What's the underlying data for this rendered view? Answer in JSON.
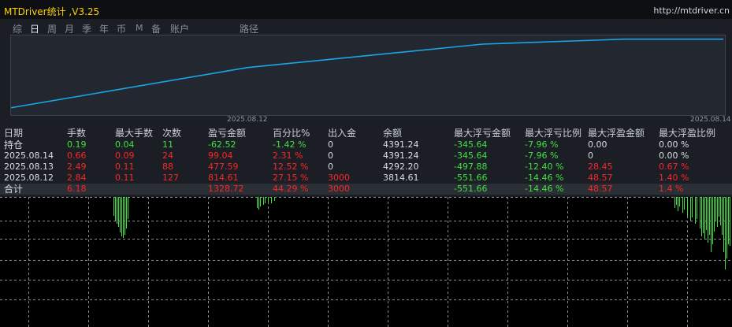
{
  "app": {
    "title": "MTDriver统计 ,V3.25",
    "url": "http://mtdriver.cn"
  },
  "period_tabs": [
    {
      "label": "综",
      "active": false
    },
    {
      "label": "日",
      "active": true
    },
    {
      "label": "周",
      "active": false
    },
    {
      "label": "月",
      "active": false
    },
    {
      "label": "季",
      "active": false
    },
    {
      "label": "年",
      "active": false
    },
    {
      "label": "币",
      "active": false
    },
    {
      "label": "M",
      "active": false
    },
    {
      "label": "备",
      "active": false
    },
    {
      "label": "账户",
      "active": false
    },
    {
      "label": "路径",
      "active": false
    }
  ],
  "equity_chart": {
    "start_date": "2025.08.12",
    "end_date": "2025.08.14",
    "line_color": "#1aa6e6",
    "values": [
      3000,
      3814.61,
      4292.2,
      4391.24,
      4391.24
    ]
  },
  "table": {
    "headers": [
      "日期",
      "手数",
      "最大手数",
      "次数",
      "盈亏金额",
      "百分比%",
      "出入金",
      "余额",
      "最大浮亏金额",
      "最大浮亏比例",
      "最大浮盈金额",
      "最大浮盈比例"
    ],
    "rows": [
      {
        "name": "positions",
        "cells": [
          "持仓",
          "0.19",
          "0.04",
          "11",
          "-62.52",
          "-1.42 %",
          "0",
          "4391.24",
          "-345.64",
          "-7.96 %",
          "0.00",
          "0.00 %"
        ],
        "colors": [
          "white",
          "green",
          "green",
          "green",
          "green",
          "green",
          "white",
          "white",
          "green",
          "green",
          "white",
          "white"
        ]
      },
      {
        "name": "day-2025-08-14",
        "cells": [
          "2025.08.14",
          "0.66",
          "0.09",
          "24",
          "99.04",
          "2.31 %",
          "0",
          "4391.24",
          "-345.64",
          "-7.96 %",
          "0",
          "0.00 %"
        ],
        "colors": [
          "white",
          "red",
          "red",
          "red",
          "red",
          "red",
          "white",
          "white",
          "green",
          "green",
          "white",
          "white"
        ]
      },
      {
        "name": "day-2025-08-13",
        "cells": [
          "2025.08.13",
          "2.49",
          "0.11",
          "88",
          "477.59",
          "12.52 %",
          "0",
          "4292.20",
          "-497.88",
          "-12.40 %",
          "28.45",
          "0.67 %"
        ],
        "colors": [
          "white",
          "red",
          "red",
          "red",
          "red",
          "red",
          "white",
          "white",
          "green",
          "green",
          "red",
          "red"
        ]
      },
      {
        "name": "day-2025-08-12",
        "cells": [
          "2025.08.12",
          "2.84",
          "0.11",
          "127",
          "814.61",
          "27.15 %",
          "3000",
          "3814.61",
          "-551.66",
          "-14.46 %",
          "48.57",
          "1.40 %"
        ],
        "colors": [
          "white",
          "red",
          "red",
          "red",
          "red",
          "red",
          "red",
          "white",
          "green",
          "green",
          "red",
          "red"
        ]
      },
      {
        "name": "total",
        "cells": [
          "合计",
          "6.18",
          "",
          "",
          "1328.72",
          "44.29 %",
          "3000",
          "",
          "-551.66",
          "-14.46 %",
          "48.57",
          "1.4 %"
        ],
        "colors": [
          "white",
          "red",
          "red",
          "red",
          "red",
          "red",
          "red",
          "white",
          "green",
          "green",
          "red",
          "red"
        ]
      }
    ]
  },
  "colors": {
    "panel_bg": "#1b1f25",
    "profit": "#ff2424",
    "loss": "#3ee23e",
    "candle": "#3ee23e",
    "grid": "#8c8c8c"
  }
}
